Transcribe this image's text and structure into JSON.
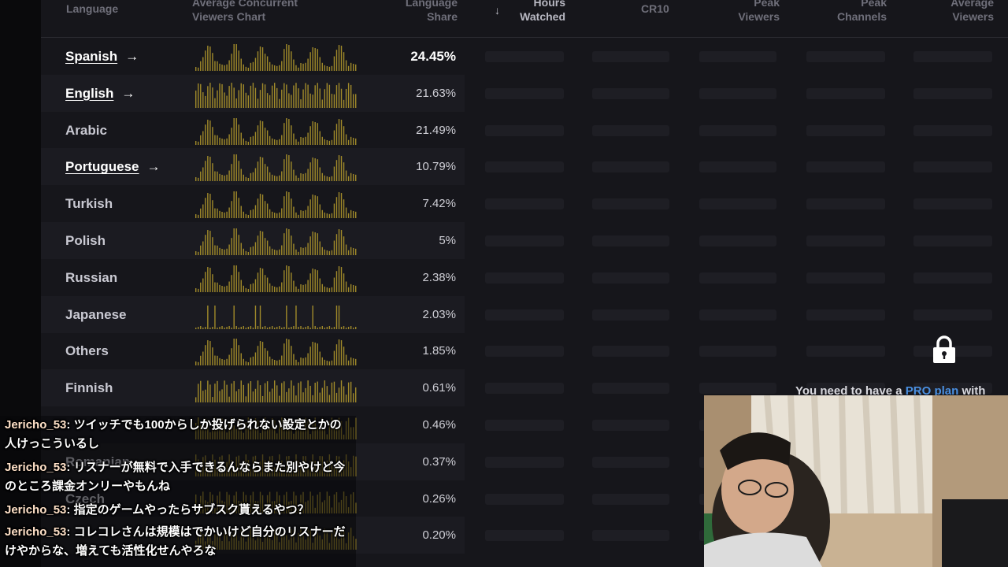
{
  "header": {
    "language": "Language",
    "chart_l1": "Average Concurrent",
    "chart_l2": "Viewers Chart",
    "share_l1": "Language",
    "share_l2": "Share",
    "sort_icon": "↓",
    "hours_l1": "Hours",
    "hours_l2": "Watched",
    "cr10": "CR10",
    "peak_viewers_l1": "Peak",
    "peak_viewers_l2": "Viewers",
    "peak_channels_l1": "Peak",
    "peak_channels_l2": "Channels",
    "avg_viewers_l1": "Average",
    "avg_viewers_l2": "Viewers"
  },
  "rows": [
    {
      "language": "Spanish",
      "share": "24.45%",
      "link": true
    },
    {
      "language": "English",
      "share": "21.63%",
      "link": true
    },
    {
      "language": "Arabic",
      "share": "21.49%",
      "link": false
    },
    {
      "language": "Portuguese",
      "share": "10.79%",
      "link": true
    },
    {
      "language": "Turkish",
      "share": "7.42%",
      "link": false
    },
    {
      "language": "Polish",
      "share": "5%",
      "link": false
    },
    {
      "language": "Russian",
      "share": "2.38%",
      "link": false
    },
    {
      "language": "Japanese",
      "share": "2.03%",
      "link": false
    },
    {
      "language": "Others",
      "share": "1.85%",
      "link": false
    },
    {
      "language": "Finnish",
      "share": "0.61%",
      "link": false
    },
    {
      "language": "",
      "share": "0.46%",
      "link": false
    },
    {
      "language": "Romanian",
      "share": "0.37%",
      "link": false
    },
    {
      "language": "Czech",
      "share": "0.26%",
      "link": false
    },
    {
      "language": "",
      "share": "0.20%",
      "link": false
    }
  ],
  "arrow_icon": "→",
  "locked": {
    "icon": "lock-icon",
    "message_prefix": "You need to have a ",
    "message_link": "PRO plan",
    "message_suffix": " with"
  },
  "chat": [
    {
      "user": "Jericho_53",
      "text": "ツイッチでも100からしか投げられない設定とかの人けっこういるし"
    },
    {
      "user": "Jericho_53",
      "text": "リスナーが無料で入手できるんならまた別やけど今のところ課金オンリーやもんね"
    },
    {
      "user": "Jericho_53",
      "text": "指定のゲームやったらサブスク貰えるやつ？"
    },
    {
      "user": "Jericho_53",
      "text": "コレコレさんは規模はでかいけど自分のリスナーだけやからな、増えても活性化せんやろな"
    }
  ],
  "colors": {
    "spark": "#a08a2a",
    "pro_link": "#4a8fe0",
    "row_alt": "#1b1b21"
  }
}
